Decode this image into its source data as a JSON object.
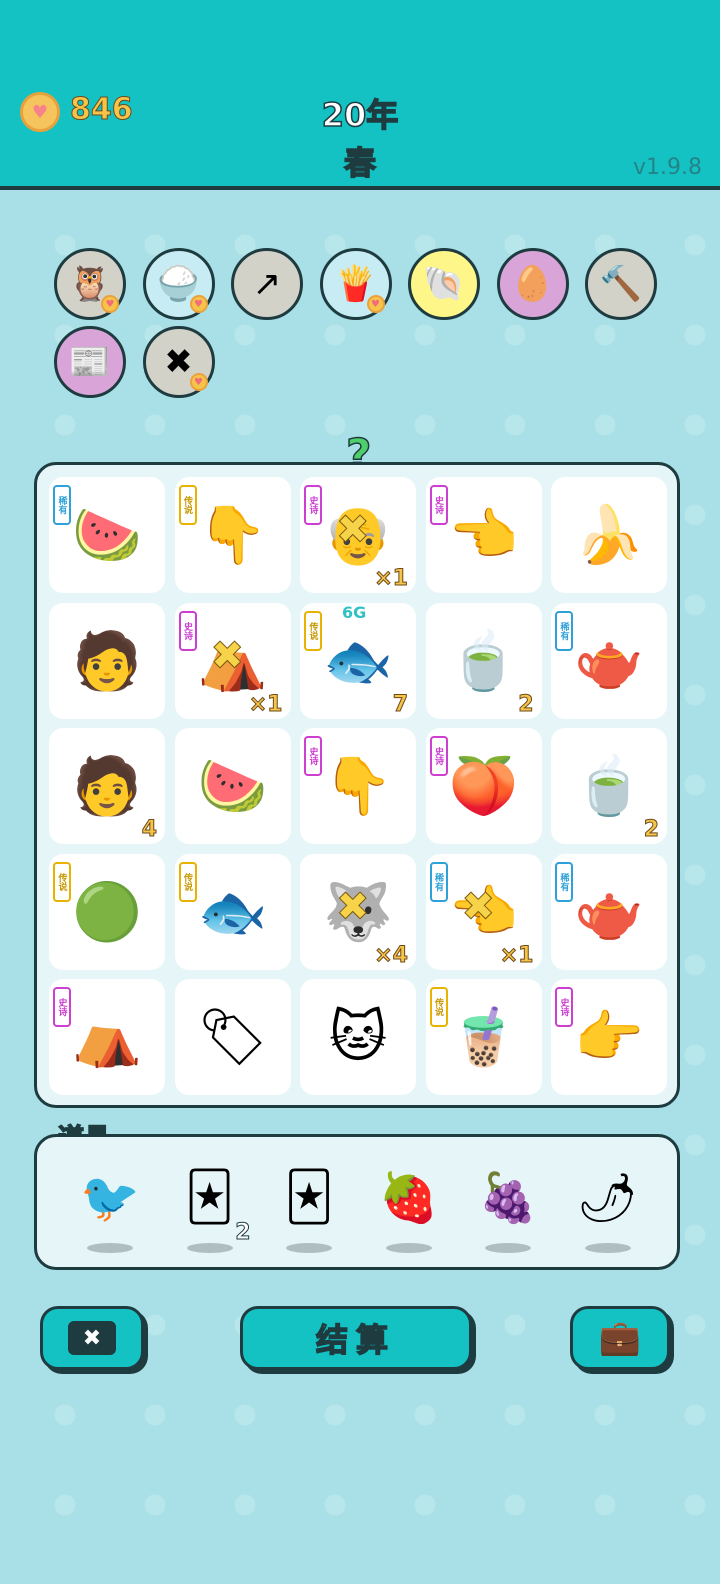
{
  "header": {
    "coins": "846",
    "year": "20年",
    "season": "春",
    "version": "v1.9.8"
  },
  "relics": [
    {
      "icon": "owl-icon",
      "glyph": "🦉",
      "bg": "#d2d2c8",
      "heart": true
    },
    {
      "icon": "rice-bowl-icon",
      "glyph": "🍚",
      "bg": "#c8ecf4",
      "heart": true
    },
    {
      "icon": "arrow-up-card-icon",
      "glyph": "↗",
      "bg": "#d2d2c8",
      "heart": false
    },
    {
      "icon": "fries-icon",
      "glyph": "🍟",
      "bg": "#c8ecf4",
      "heart": true
    },
    {
      "icon": "shell-icon",
      "glyph": "🐚",
      "bg": "#fff68a",
      "heart": false
    },
    {
      "icon": "egg-icon",
      "glyph": "🥚",
      "bg": "#d9a4d8",
      "heart": false
    },
    {
      "icon": "hammer-icon",
      "glyph": "🔨",
      "bg": "#d2d2c8",
      "heart": false
    },
    {
      "icon": "time-magazine-icon",
      "glyph": "📰",
      "bg": "#d9a4d8",
      "heart": false
    },
    {
      "icon": "skip-card-icon",
      "glyph": "✖",
      "bg": "#d2d2c8",
      "heart": true
    }
  ],
  "board_hint": "?",
  "board": [
    {
      "icon": "watermelon-slice-icon",
      "glyph": "🍉",
      "tag": "稀有",
      "tier": "rare",
      "num": "",
      "x": false
    },
    {
      "icon": "pointing-finger-gold-icon",
      "glyph": "👇",
      "tag": "传说",
      "tier": "legend",
      "num": "",
      "x": false
    },
    {
      "icon": "old-farmer-icon",
      "glyph": "👴",
      "tag": "史诗",
      "tier": "epic",
      "num": "×1",
      "x": true
    },
    {
      "icon": "pointing-finger-gray-icon",
      "glyph": "👈",
      "tag": "史诗",
      "tier": "epic",
      "num": "",
      "x": false
    },
    {
      "icon": "banana-icon",
      "glyph": "🍌",
      "tag": "",
      "tier": "",
      "num": "",
      "x": false
    },
    {
      "icon": "man-face-icon",
      "glyph": "🧑",
      "tag": "",
      "tier": "",
      "num": "",
      "x": false
    },
    {
      "icon": "rabbit-tent-icon",
      "glyph": "⛺",
      "tag": "史诗",
      "tier": "epic",
      "num": "×1",
      "x": true
    },
    {
      "icon": "koi-fish-icon",
      "glyph": "🐟",
      "tag": "传说",
      "tier": "legend",
      "num": "7",
      "x": false,
      "badge": "6G"
    },
    {
      "icon": "tea-bowl-icon",
      "glyph": "🍵",
      "tag": "",
      "tier": "",
      "num": "2",
      "x": false
    },
    {
      "icon": "teapot-icon",
      "glyph": "🫖",
      "tag": "稀有",
      "tier": "rare",
      "num": "",
      "x": false
    },
    {
      "icon": "man-face-icon",
      "glyph": "🧑",
      "tag": "",
      "tier": "",
      "num": "4",
      "x": false
    },
    {
      "icon": "watermelon-slice-icon",
      "glyph": "🍉",
      "tag": "",
      "tier": "",
      "num": "",
      "x": false
    },
    {
      "icon": "pointing-finger-gray-icon",
      "glyph": "👇",
      "tag": "史诗",
      "tier": "epic",
      "num": "",
      "x": false
    },
    {
      "icon": "peach-icon",
      "glyph": "🍑",
      "tag": "史诗",
      "tier": "epic",
      "num": "",
      "x": false
    },
    {
      "icon": "tea-bowl-icon",
      "glyph": "🍵",
      "tag": "",
      "tier": "",
      "num": "2",
      "x": false
    },
    {
      "icon": "watermelon-icon",
      "glyph": "🟢",
      "tag": "传说",
      "tier": "legend",
      "num": "",
      "x": false
    },
    {
      "icon": "koi-fish-icon",
      "glyph": "🐟",
      "tag": "传说",
      "tier": "legend",
      "num": "",
      "x": false
    },
    {
      "icon": "husky-dog-icon",
      "glyph": "🐺",
      "tag": "",
      "tier": "",
      "num": "×4",
      "x": true
    },
    {
      "icon": "pointing-finger-brown-icon",
      "glyph": "👈",
      "tag": "稀有",
      "tier": "rare",
      "num": "×1",
      "x": true
    },
    {
      "icon": "teapot-icon",
      "glyph": "🫖",
      "tag": "稀有",
      "tier": "rare",
      "num": "",
      "x": false
    },
    {
      "icon": "rabbit-tent-icon",
      "glyph": "⛺",
      "tag": "史诗",
      "tier": "epic",
      "num": "",
      "x": false
    },
    {
      "icon": "tea-bag-icon",
      "glyph": "🏷",
      "tag": "",
      "tier": "",
      "num": "",
      "x": false
    },
    {
      "icon": "cat-icon",
      "glyph": "🐱",
      "tag": "",
      "tier": "",
      "num": "",
      "x": false
    },
    {
      "icon": "bubble-tea-icon",
      "glyph": "🧋",
      "tag": "传说",
      "tier": "legend",
      "num": "",
      "x": false
    },
    {
      "icon": "pointing-hand-icon",
      "glyph": "👉",
      "tag": "史诗",
      "tier": "epic",
      "num": "",
      "x": false
    }
  ],
  "props": {
    "title": "道具",
    "items": [
      {
        "icon": "white-bird-icon",
        "glyph": "🐦",
        "num": ""
      },
      {
        "icon": "rare-cards-icon",
        "glyph": "🃏",
        "num": "2"
      },
      {
        "icon": "epic-cards-icon",
        "glyph": "🃏",
        "num": ""
      },
      {
        "icon": "strawberry-icon",
        "glyph": "🍓",
        "num": ""
      },
      {
        "icon": "bayberry-icon",
        "glyph": "🍇",
        "num": ""
      },
      {
        "icon": "chili-pepper-icon",
        "glyph": "🌶",
        "num": ""
      }
    ]
  },
  "actions": {
    "skip_glyph": "✖",
    "settle_label": "结算",
    "bag_glyph": "💼"
  }
}
